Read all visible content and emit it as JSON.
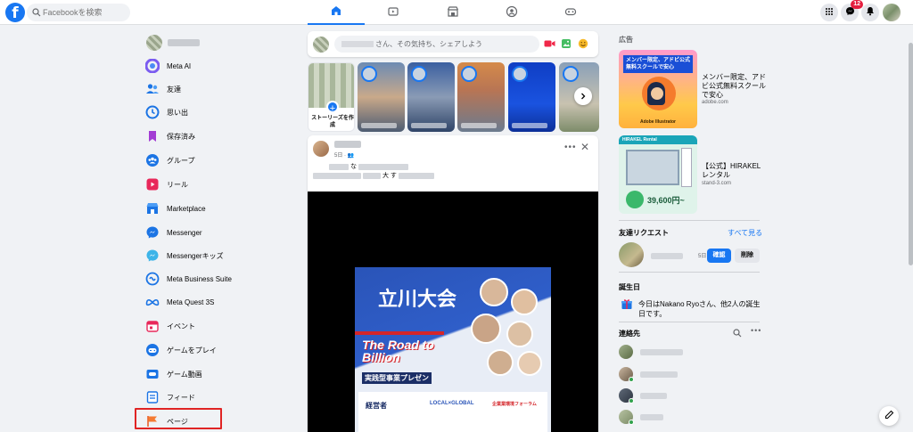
{
  "topbar": {
    "search_placeholder": "Facebookを検索",
    "notification_badge": "12",
    "nav_tabs": [
      "home-tab",
      "video-tab",
      "marketplace-tab",
      "groups-tab",
      "gaming-tab"
    ]
  },
  "sidebar": {
    "items": [
      {
        "label": "Meta AI",
        "icon": "meta-ai-icon"
      },
      {
        "label": "友達",
        "icon": "friends-icon"
      },
      {
        "label": "思い出",
        "icon": "memories-icon"
      },
      {
        "label": "保存済み",
        "icon": "saved-icon"
      },
      {
        "label": "グループ",
        "icon": "groups-icon"
      },
      {
        "label": "リール",
        "icon": "reels-icon"
      },
      {
        "label": "Marketplace",
        "icon": "marketplace-icon"
      },
      {
        "label": "Messenger",
        "icon": "messenger-icon"
      },
      {
        "label": "Messengerキッズ",
        "icon": "messenger-kids-icon"
      },
      {
        "label": "Meta Business Suite",
        "icon": "business-suite-icon"
      },
      {
        "label": "Meta Quest 3S",
        "icon": "meta-quest-icon"
      },
      {
        "label": "イベント",
        "icon": "events-icon"
      },
      {
        "label": "ゲームをプレイ",
        "icon": "play-games-icon"
      },
      {
        "label": "ゲーム動画",
        "icon": "gaming-video-icon"
      },
      {
        "label": "フィード",
        "icon": "feeds-icon"
      },
      {
        "label": "ページ",
        "icon": "pages-icon"
      }
    ]
  },
  "composer": {
    "placeholder": "さん、その気持ち、シェアしよう"
  },
  "stories": {
    "create_label": "ストーリーズを作成"
  },
  "post": {
    "meta": "5日 · ",
    "text_line1": "な",
    "text_line2": "大 す",
    "poster": {
      "title": "立川大会",
      "headline": "The Road to Billion",
      "subheadline": "実践型事業プレゼン",
      "bottom_left": "経営者",
      "bottom_mid": "LOCAL×GLOBAL",
      "bottom_right": "企業業環境フォーラム"
    }
  },
  "right": {
    "ads_heading": "広告",
    "ads": [
      {
        "text": "メンバー限定、アドビ公式無料スクールで安心",
        "url": "adobe.com",
        "img_caption": "メンバー限定、アドビ公式 無料スクールで安心",
        "brand": "Adobe Illustrator"
      },
      {
        "text": "【公式】HIRAKEL レンタル",
        "url": "stand-3.com",
        "img_title": "HIRAKEL Rental",
        "price": "39,600円~"
      }
    ],
    "friend_requests_heading": "友達リクエスト",
    "see_all": "すべて見る",
    "request_age": "5日",
    "confirm_label": "確認",
    "delete_label": "削除",
    "birthday_heading": "誕生日",
    "birthday_text": "今日はNakano Ryoさん、他2人の誕生日です。",
    "contacts_heading": "連絡先"
  }
}
